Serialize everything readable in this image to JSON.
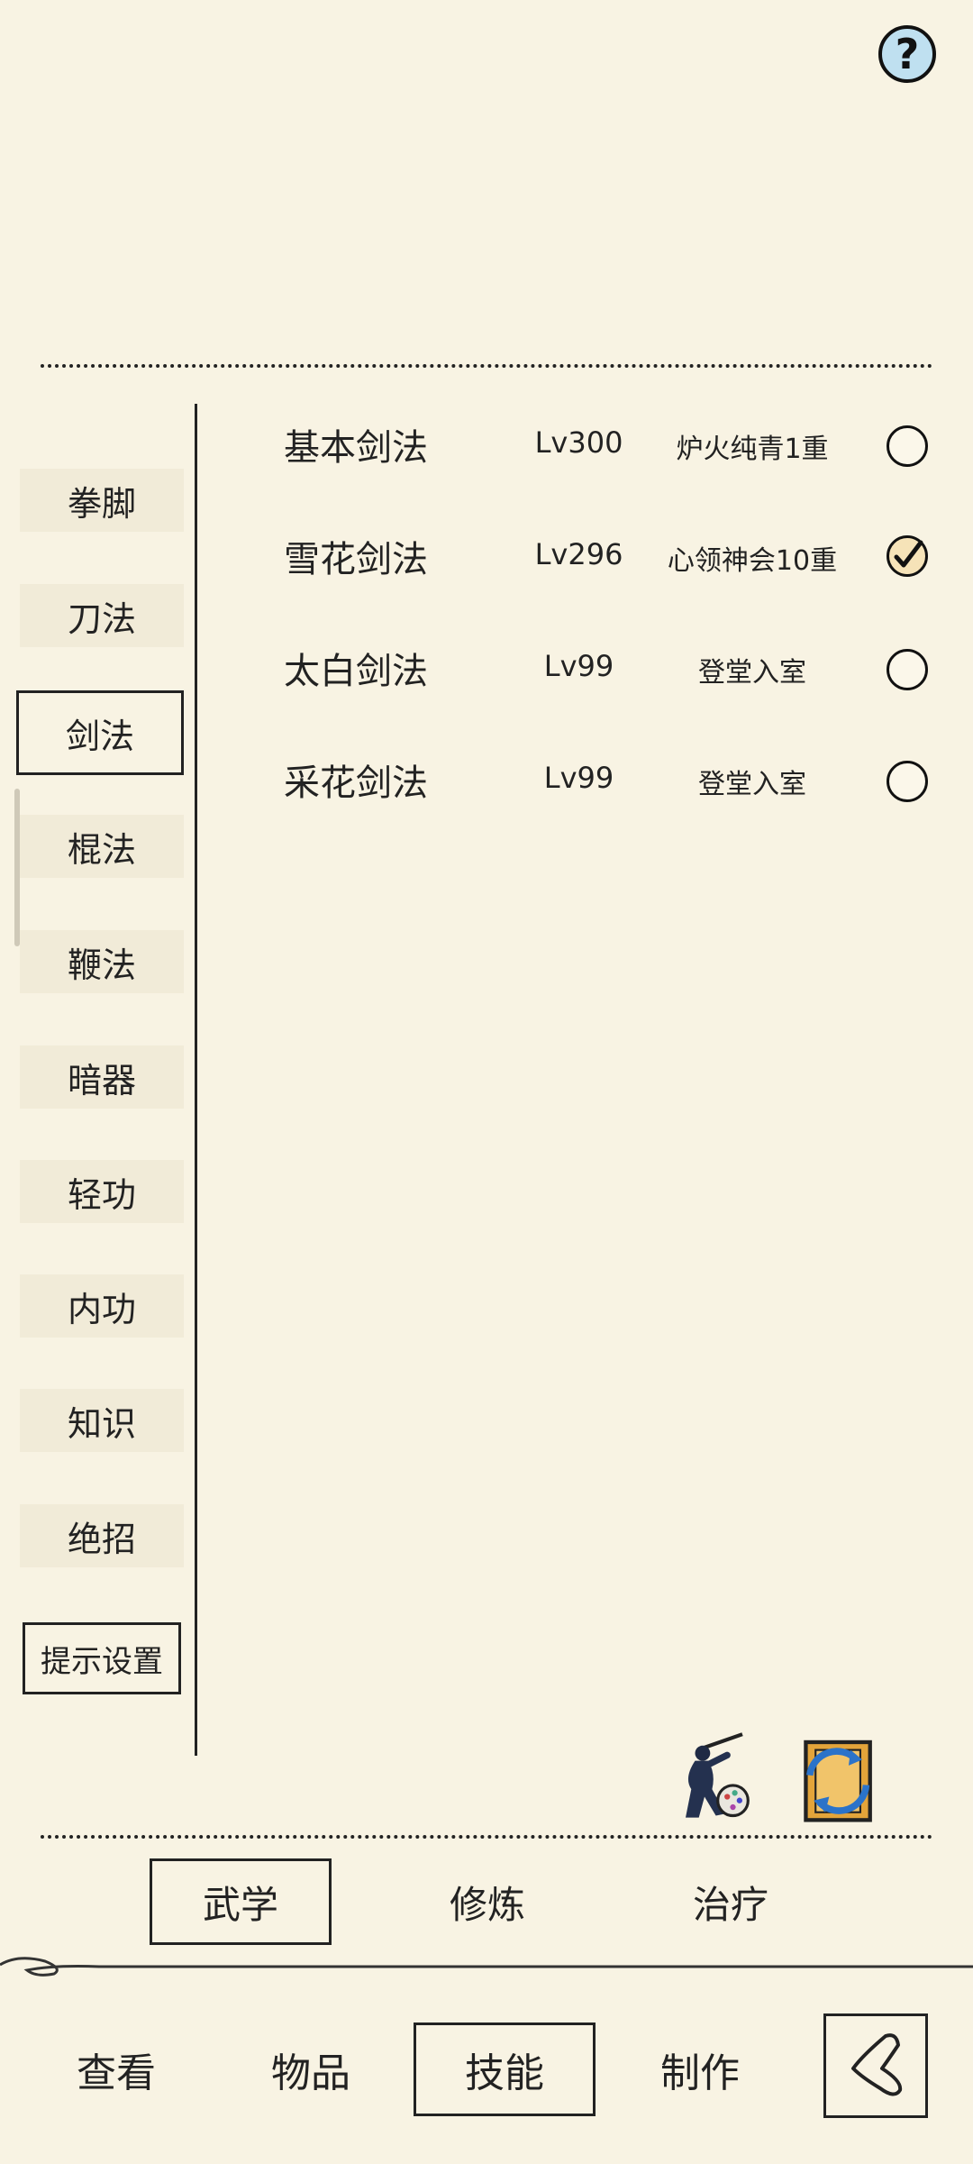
{
  "help": {
    "icon": "question-icon",
    "label": "?"
  },
  "categories": [
    {
      "label": "拳脚"
    },
    {
      "label": "刀法"
    },
    {
      "label": "剑法",
      "active": true
    },
    {
      "label": "棍法"
    },
    {
      "label": "鞭法"
    },
    {
      "label": "暗器"
    },
    {
      "label": "轻功"
    },
    {
      "label": "内功"
    },
    {
      "label": "知识"
    },
    {
      "label": "绝招"
    }
  ],
  "hint_settings_label": "提示设置",
  "skills": [
    {
      "name": "基本剑法",
      "level": "Lv300",
      "state": "炉火纯青1重",
      "checked": false
    },
    {
      "name": "雪花剑法",
      "level": "Lv296",
      "state": "心领神会10重",
      "checked": true
    },
    {
      "name": "太白剑法",
      "level": "Lv99",
      "state": "登堂入室",
      "checked": false
    },
    {
      "name": "采花剑法",
      "level": "Lv99",
      "state": "登堂入室",
      "checked": false
    }
  ],
  "action_icons": {
    "character": "swordsman-icon",
    "swap": "swap-book-icon"
  },
  "subtabs": [
    {
      "label": "武学",
      "active": true
    },
    {
      "label": "修炼"
    },
    {
      "label": "治疗"
    }
  ],
  "bottom_nav": [
    {
      "label": "查看"
    },
    {
      "label": "物品"
    },
    {
      "label": "技能",
      "active": true
    },
    {
      "label": "制作"
    }
  ],
  "back_icon": "back-chevron-icon",
  "colors": {
    "background": "#f8f3e3",
    "ink": "#222222",
    "help_blue": "#bfe0f0",
    "check_fill": "#f6e3b8"
  }
}
